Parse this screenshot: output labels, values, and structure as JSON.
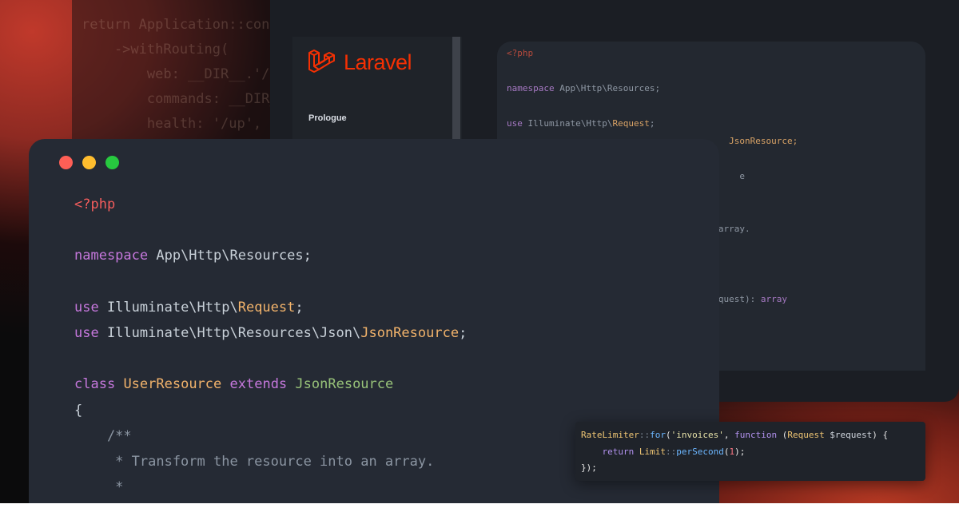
{
  "background_code": {
    "lines": [
      "return Application::conf",
      "    ->withRouting(",
      "        web: __DIR__.'/.",
      "        commands: __DIR_",
      "        health: '/up',"
    ]
  },
  "docs_window": {
    "logo_text": "Laravel",
    "sidebar": {
      "items": [
        {
          "label": "Prologue"
        }
      ]
    },
    "code_preview": {
      "line1": "<?php",
      "ns_kw": "namespace",
      "ns_rest": " App\\Http\\Resources;",
      "use_kw": "use",
      "use1_rest": " Illuminate\\Http\\",
      "use1_class": "Request",
      "use1_end": ";",
      "frag_jsonresource": "JsonResource;",
      "frag_e": "e",
      "frag_array": "array.",
      "frag_request": "equest): ",
      "frag_array_kw": "array"
    }
  },
  "editor": {
    "traffic_lights": {
      "close": "#ff5f56",
      "minimize": "#ffbd2e",
      "maximize": "#27c93f"
    },
    "code": {
      "open_tag": "<?php",
      "namespace_kw": "namespace",
      "namespace_path": " App\\Http\\Resources;",
      "use_kw": "use",
      "use1_path": " Illuminate\\Http\\",
      "use1_class": "Request",
      "use2_path": " Illuminate\\Http\\Resources\\Json\\",
      "use2_class": "JsonResource",
      "semicolon": ";",
      "class_kw": "class",
      "class_name": "UserResource",
      "extends_kw": "extends",
      "parent_class": "JsonResource",
      "open_brace": "{",
      "doc_open": "    /**",
      "doc_line": "     * Transform the resource into an array.",
      "doc_star": "     *"
    }
  },
  "snippet": {
    "line1_class": "RateLimiter",
    "line1_op": "::",
    "line1_fn": "for",
    "line1_p1": "(",
    "line1_str": "'invoices'",
    "line1_p2": ", ",
    "line1_kw": "function",
    "line1_p3": " (",
    "line1_type": "Request",
    "line1_var": " $request",
    "line1_end": ") {",
    "line2_indent": "    ",
    "line2_kw": "return",
    "line2_class": " Limit",
    "line2_op": "::",
    "line2_fn": "perSecond",
    "line2_p1": "(",
    "line2_num": "1",
    "line2_end": ");",
    "line3": "});"
  },
  "colors": {
    "brand_red": "#f53003",
    "editor_bg": "#252a34"
  }
}
